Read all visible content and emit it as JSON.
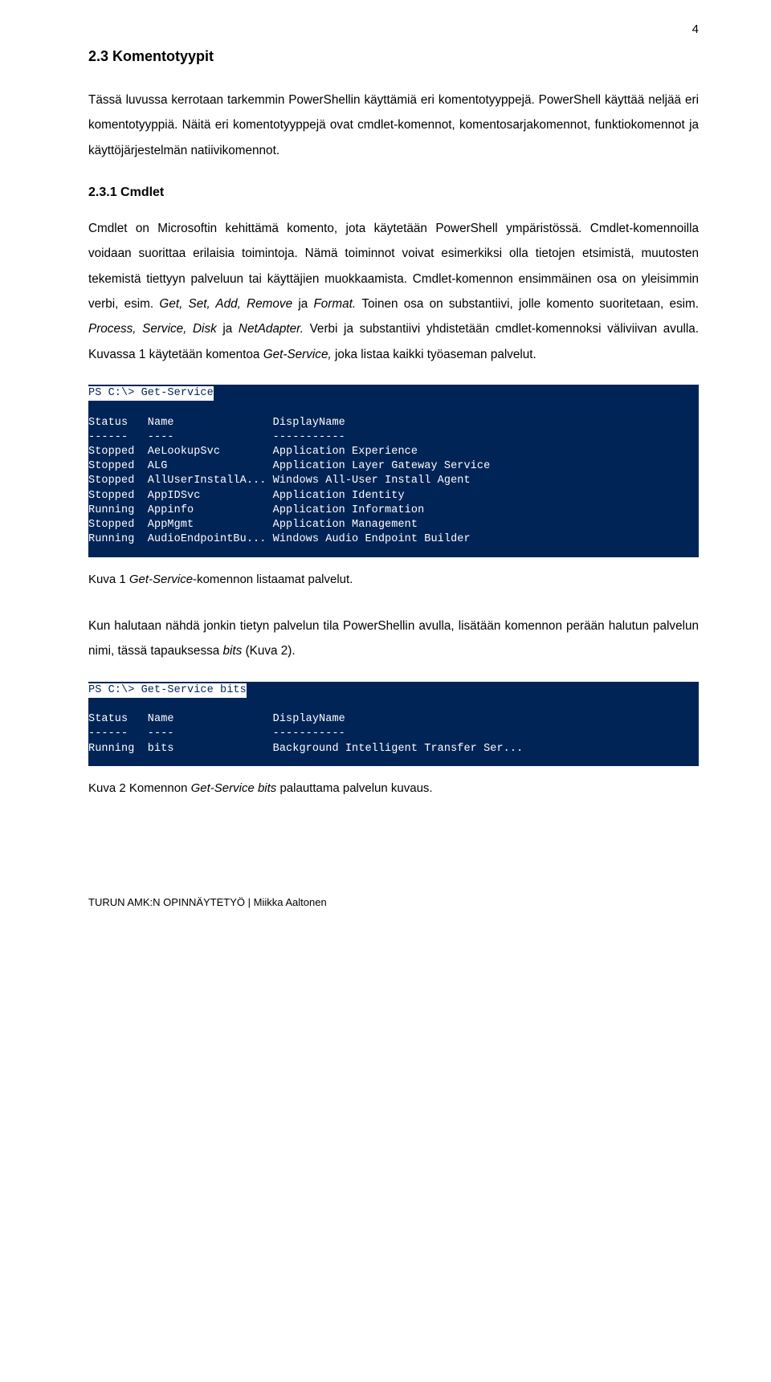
{
  "page_number": "4",
  "heading": "2.3 Komentotyypit",
  "para1": "Tässä luvussa kerrotaan tarkemmin PowerShellin käyttämiä eri komentotyyppejä. PowerShell käyttää neljää eri komentotyyppiä. Näitä eri komentotyyppejä ovat cmdlet-komennot, komentosarjakomennot, funktiokomennot ja käyttöjärjestelmän natiivikomennot.",
  "subheading": "2.3.1 Cmdlet",
  "para2_a": "Cmdlet on Microsoftin kehittämä komento, jota käytetään PowerShell ympäristössä. Cmdlet-komennoilla voidaan suorittaa erilaisia toimintoja. Nämä toiminnot voivat esimerkiksi olla tietojen etsimistä, muutosten tekemistä tiettyyn palveluun tai käyttäjien muokkaamista. Cmdlet-komennon ensimmäinen osa on yleisimmin verbi, esim. ",
  "para2_b": "Get, Set, Add, Remove ",
  "para2_c": "ja ",
  "para2_d": "Format. ",
  "para2_e": "Toinen osa on substantiivi, jolle komento suoritetaan, esim. ",
  "para2_f": "Process, Service, Disk ",
  "para2_g": "ja ",
  "para2_h": "NetAdapter. ",
  "para2_i": "Verbi ja substantiivi yhdistetään cmdlet-komennoksi väliviivan avulla. Kuvassa 1 käytetään komentoa ",
  "para2_j": "Get-Service, ",
  "para2_k": "joka listaa kaikki työaseman palvelut.",
  "console1": {
    "prompt": "PS C:\\> Get-Service",
    "header": "Status   Name               DisplayName",
    "divider": "------   ----               -----------",
    "rows": [
      "Stopped  AeLookupSvc        Application Experience",
      "Stopped  ALG                Application Layer Gateway Service",
      "Stopped  AllUserInstallA... Windows All-User Install Agent",
      "Stopped  AppIDSvc           Application Identity",
      "Running  Appinfo            Application Information",
      "Stopped  AppMgmt            Application Management",
      "Running  AudioEndpointBu... Windows Audio Endpoint Builder"
    ]
  },
  "caption1_a": "Kuva 1 ",
  "caption1_b": "Get-Service",
  "caption1_c": "-komennon listaamat palvelut.",
  "para3_a": "Kun halutaan nähdä jonkin tietyn palvelun tila PowerShellin avulla, lisätään komennon perään halutun palvelun nimi, tässä tapauksessa ",
  "para3_b": "bits ",
  "para3_c": "(Kuva 2).",
  "console2": {
    "prompt": "PS C:\\> Get-Service bits",
    "header": "Status   Name               DisplayName",
    "divider": "------   ----               -----------",
    "rows": [
      "Running  bits               Background Intelligent Transfer Ser..."
    ]
  },
  "caption2_a": "Kuva 2 Komennon ",
  "caption2_b": "Get-Service bits ",
  "caption2_c": "palauttama palvelun kuvaus.",
  "footer": "TURUN AMK:N OPINNÄYTETYÖ | Miikka Aaltonen"
}
